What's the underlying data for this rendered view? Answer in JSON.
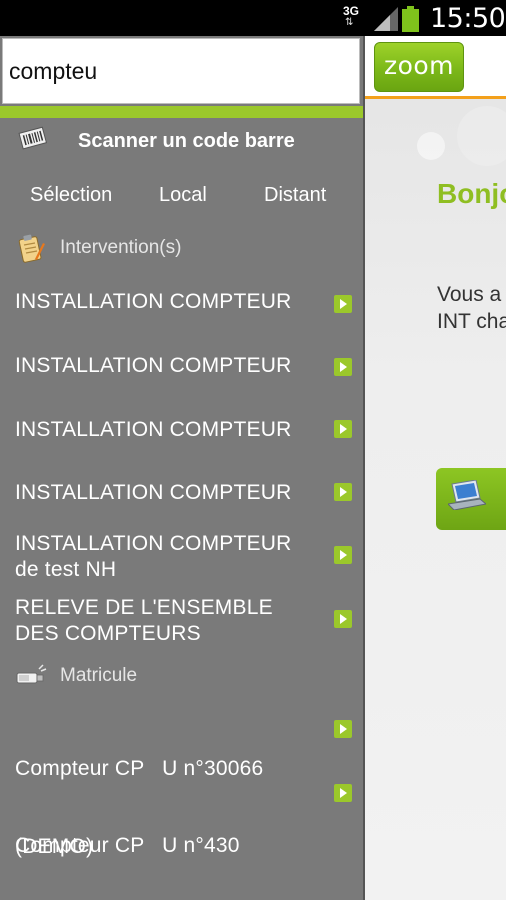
{
  "status_bar": {
    "network": "3G",
    "time": "15:50",
    "icons": [
      "signal-icon",
      "battery-icon"
    ]
  },
  "search": {
    "value": "compteu"
  },
  "scan": {
    "label": "Scanner un code barre",
    "icon": "barcode-scanner-icon"
  },
  "tabs": [
    {
      "label": "Sélection"
    },
    {
      "label": "Local"
    },
    {
      "label": "Distant"
    }
  ],
  "sections": {
    "interventions": {
      "label": "Intervention(s)",
      "icon": "clipboard-icon"
    },
    "matricule": {
      "label": "Matricule",
      "icon": "meter-icon"
    }
  },
  "interventions": [
    {
      "line1": "INSTALLATION COMPTEUR",
      "line2": ""
    },
    {
      "line1": "INSTALLATION COMPTEUR",
      "line2": ""
    },
    {
      "line1": "INSTALLATION COMPTEUR",
      "line2": ""
    },
    {
      "line1": "INSTALLATION COMPTEUR",
      "line2": ""
    },
    {
      "line1": "INSTALLATION COMPTEUR",
      "line2": "de test NH"
    },
    {
      "line1": "RELEVE DE L'ENSEMBLE",
      "line2": "DES COMPTEURS"
    }
  ],
  "matricules": [
    {
      "line1": "Compteur CP   U n°30066",
      "line2": "(DEMO)"
    },
    {
      "line1": "Compteur CP   U n°430",
      "line2": ""
    }
  ],
  "main": {
    "zoom_label": "zoom",
    "greeting": "Bonjo",
    "intro_line1": "Vous a",
    "intro_line2": "INT cha"
  },
  "colors": {
    "accent_green": "#9bc82b",
    "drawer_bg": "#7a7a7a",
    "orange_rule": "#f3a01b"
  }
}
